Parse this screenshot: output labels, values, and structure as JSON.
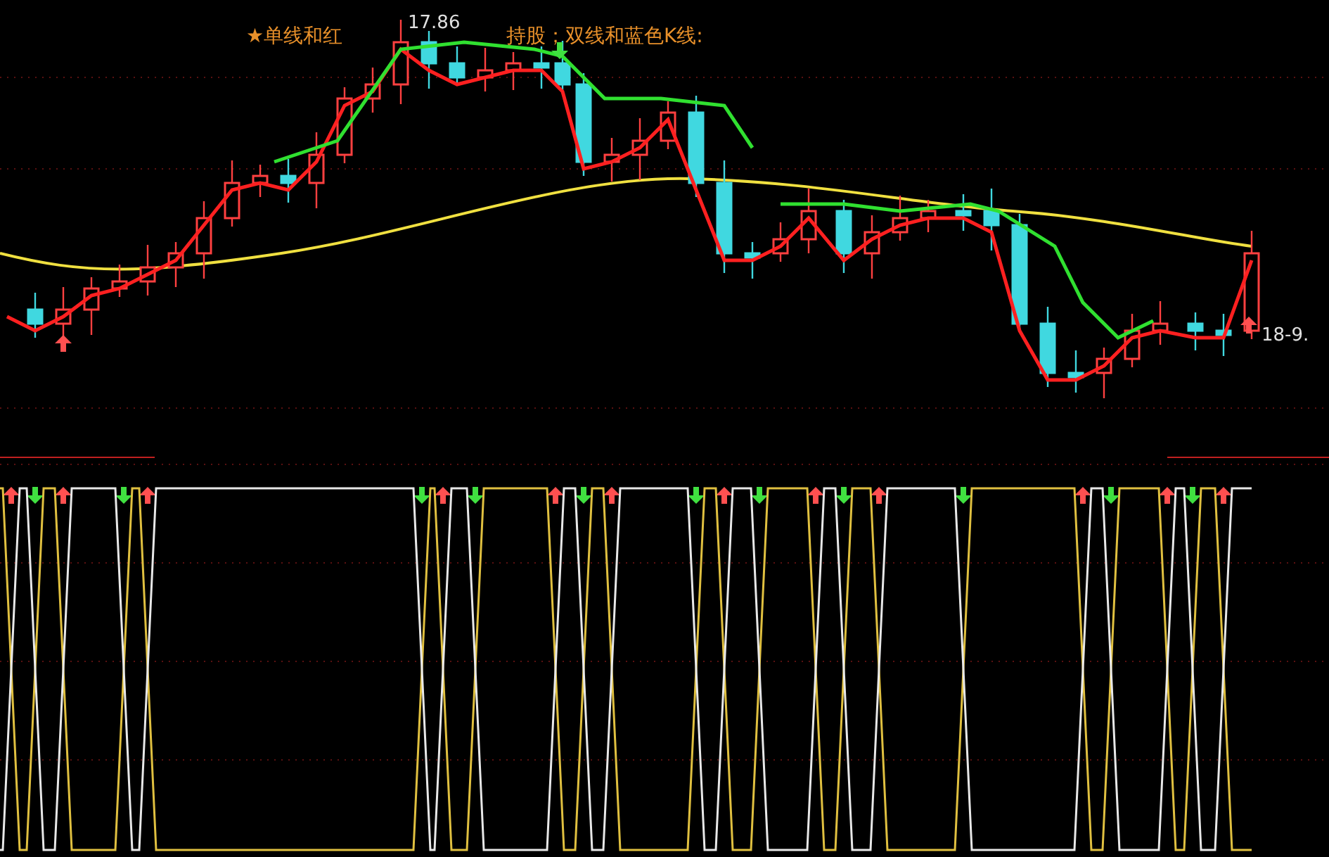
{
  "main_chart": {
    "legend": [
      "★单线和红",
      "持股；双线和蓝色K线:"
    ],
    "high_label": "17.86",
    "last_label": "18-9."
  }
}
